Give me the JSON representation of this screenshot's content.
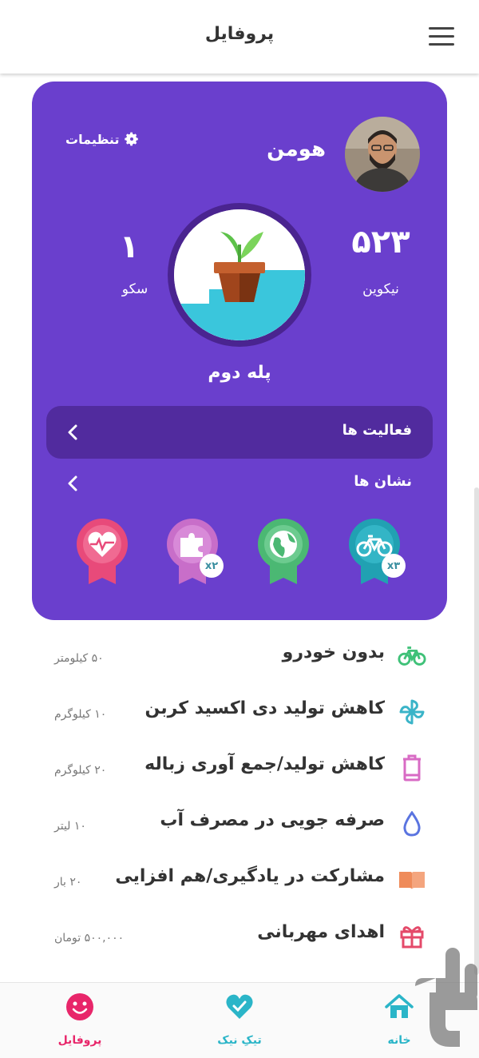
{
  "header": {
    "title": "پروفایل"
  },
  "profile": {
    "name": "هومن",
    "settings_label": "تنظیمات",
    "coins_value": "۵۲۳",
    "coins_label": "نیکوین",
    "steps_value": "۱",
    "steps_label": "سکو",
    "level_name": "پله دوم"
  },
  "sections": {
    "activities_label": "فعالیت ها",
    "badges_label": "نشان ها"
  },
  "badges": [
    {
      "icon": "heart-icon",
      "color": "#e84a7a",
      "multiplier": ""
    },
    {
      "icon": "puzzle-icon",
      "color": "#c86ec9",
      "multiplier": "x۲"
    },
    {
      "icon": "globe-icon",
      "color": "#4bb873",
      "multiplier": ""
    },
    {
      "icon": "bicycle-icon",
      "color": "#21a1b2",
      "multiplier": "x۳"
    }
  ],
  "activities": [
    {
      "icon": "bicycle-icon",
      "label": "بدون خودرو",
      "value": "۵۰ کیلومتر",
      "color": "#3fc178"
    },
    {
      "icon": "pinwheel-icon",
      "label": "کاهش تولید دی اکسید کربن",
      "value": "۱۰ کیلوگرم",
      "color": "#3ab4c8"
    },
    {
      "icon": "trash-icon",
      "label": "کاهش تولید/جمع آوری زباله",
      "value": "۲۰ کیلوگرم",
      "color": "#d86bc4"
    },
    {
      "icon": "water-drop-icon",
      "label": "صرفه جویی در مصرف آب",
      "value": "۱۰ لیتر",
      "color": "#5a74e0"
    },
    {
      "icon": "book-icon",
      "label": "مشارکت در یادگیری/هم افزایی",
      "value": "۲۰ بار",
      "color": "#ef8b5a"
    },
    {
      "icon": "gift-icon",
      "label": "اهدای مهربانی",
      "value": "۵۰۰,۰۰۰ تومان",
      "color": "#e44a6a"
    }
  ],
  "nav": {
    "profile_label": "پروفایل",
    "tik_label": "تیکِ نیک",
    "home_label": "خانه",
    "profile_color": "#e8266a",
    "tik_color": "#2bb5c8",
    "home_color": "#2bb5c8"
  }
}
